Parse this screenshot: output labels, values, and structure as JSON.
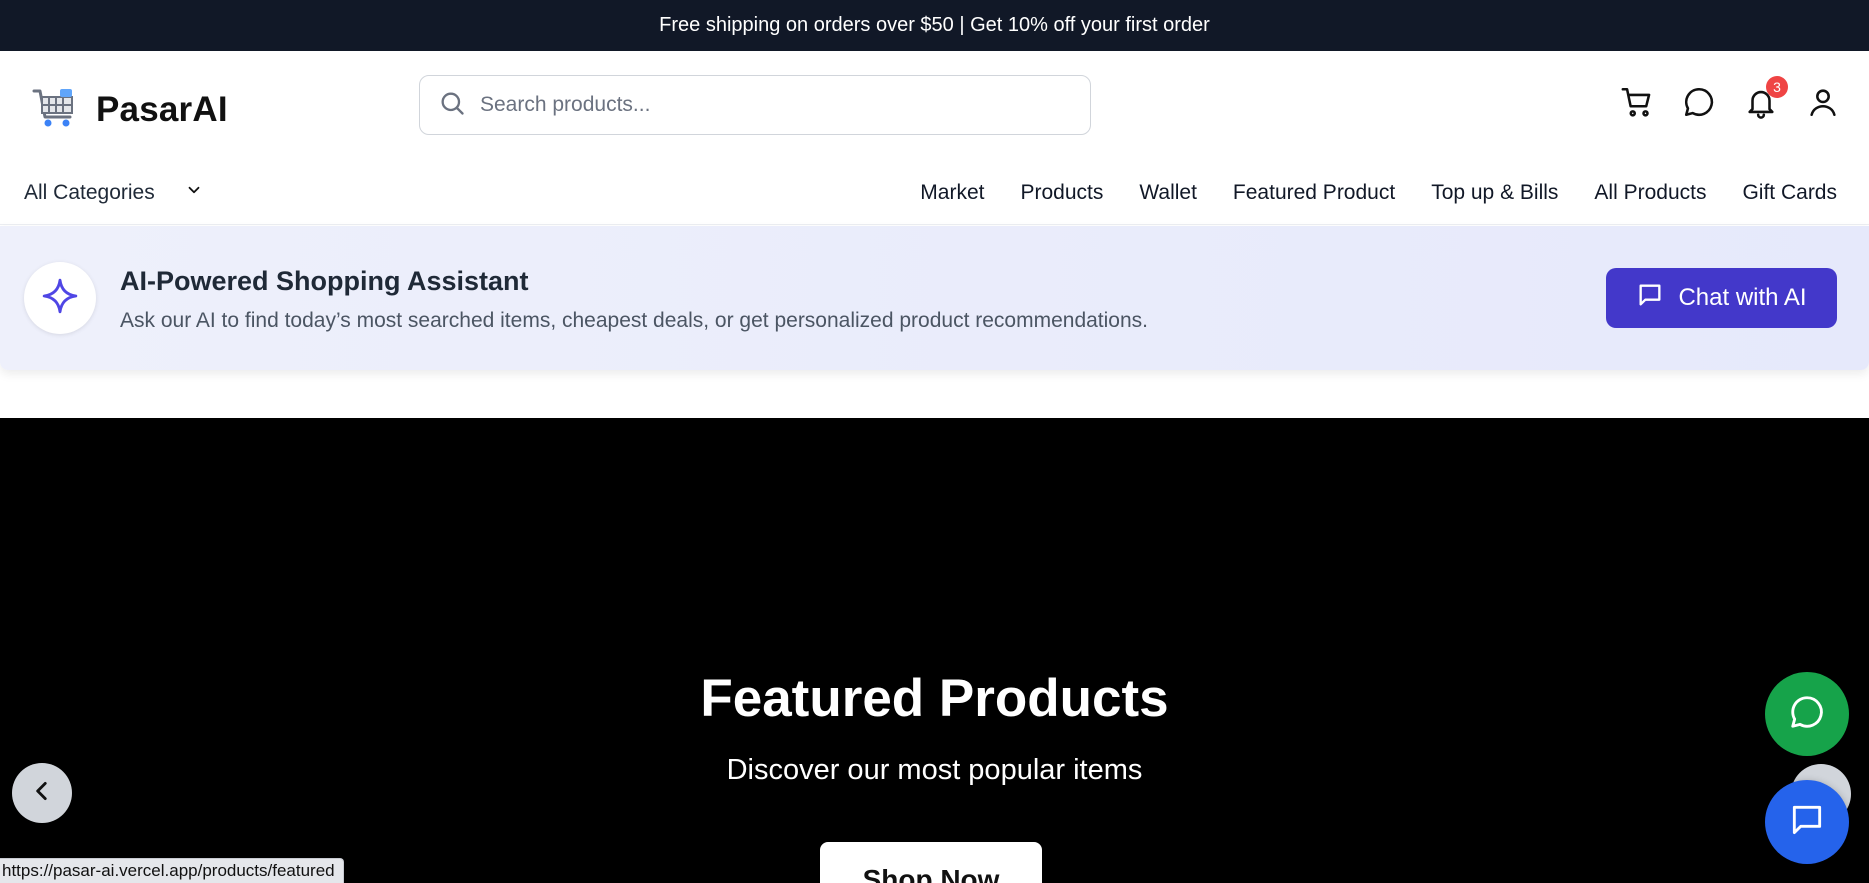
{
  "promo": {
    "text": "Free shipping on orders over $50 | Get 10% off your first order"
  },
  "header": {
    "logo_text": "PasarAI",
    "search_placeholder": "Search products...",
    "notifications_count": "3"
  },
  "nav": {
    "categories_label": "All Categories",
    "links": [
      "Market",
      "Products",
      "Wallet",
      "Featured Product",
      "Top up & Bills",
      "All Products",
      "Gift Cards"
    ]
  },
  "ai_banner": {
    "title": "AI-Powered Shopping Assistant",
    "subtitle": "Ask our AI to find today’s most searched items, cheapest deals, or get personalized product recommendations.",
    "button_label": "Chat with AI"
  },
  "hero": {
    "title": "Featured Products",
    "subtitle": "Discover our most popular items",
    "button_label": "Shop Now"
  },
  "status_bar": {
    "url": "https://pasar-ai.vercel.app/products/featured"
  },
  "colors": {
    "promo_bg": "#111827",
    "accent": "#4338ca",
    "badge": "#ef4444",
    "whatsapp": "#16a34a",
    "chat_fab": "#2563eb"
  }
}
